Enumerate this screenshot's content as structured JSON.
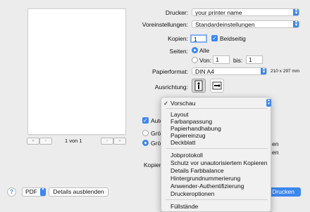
{
  "preview": {
    "prev_first": "«",
    "prev": "‹",
    "page_info": "1 von 1",
    "next": "›",
    "next_last": "»"
  },
  "settings": {
    "printer_label": "Drucker:",
    "printer_value": "your printer name",
    "presets_label": "Voreinstellungen:",
    "presets_value": "Standardeinstellungen",
    "copies_label": "Kopien:",
    "copies_value": "1",
    "duplex_label": "Beidseitig",
    "pages_label": "Seiten:",
    "pages_all": "Alle",
    "pages_from": "Von:",
    "pages_from_value": "1",
    "pages_to": "bis:",
    "pages_to_value": "1",
    "paper_label": "Papierformat:",
    "paper_value": "DIN A4",
    "paper_dims": "210 x 297 mm",
    "orientation_label": "Ausrichtung:"
  },
  "behind": {
    "auto_label": "Auto",
    "size1": "Grö",
    "size2": "Grö",
    "size1_right": "en",
    "size2_right": "en",
    "copies_prefix": "Kopien"
  },
  "menu": {
    "checked": "✓",
    "section1": [
      "Vorschau"
    ],
    "section2": [
      "Layout",
      "Farbanpassung",
      "Papierhandhabung",
      "Papiereinzug",
      "Deckblatt"
    ],
    "section3": [
      "Jobprotokoll",
      "Schutz vor unautorisiertem Kopieren",
      "Details Farbbalance",
      "Hintergrundnummerierung",
      "Anwender-Authentifizierung",
      "Druckeroptionen"
    ],
    "section4": [
      "Füllstände"
    ]
  },
  "bottom": {
    "help": "?",
    "pdf_label": "PDF",
    "details_label": "Details ausblenden",
    "print_label": "Drucken"
  },
  "colors": {
    "accent": "#3c86f0",
    "background": "#ececec"
  }
}
